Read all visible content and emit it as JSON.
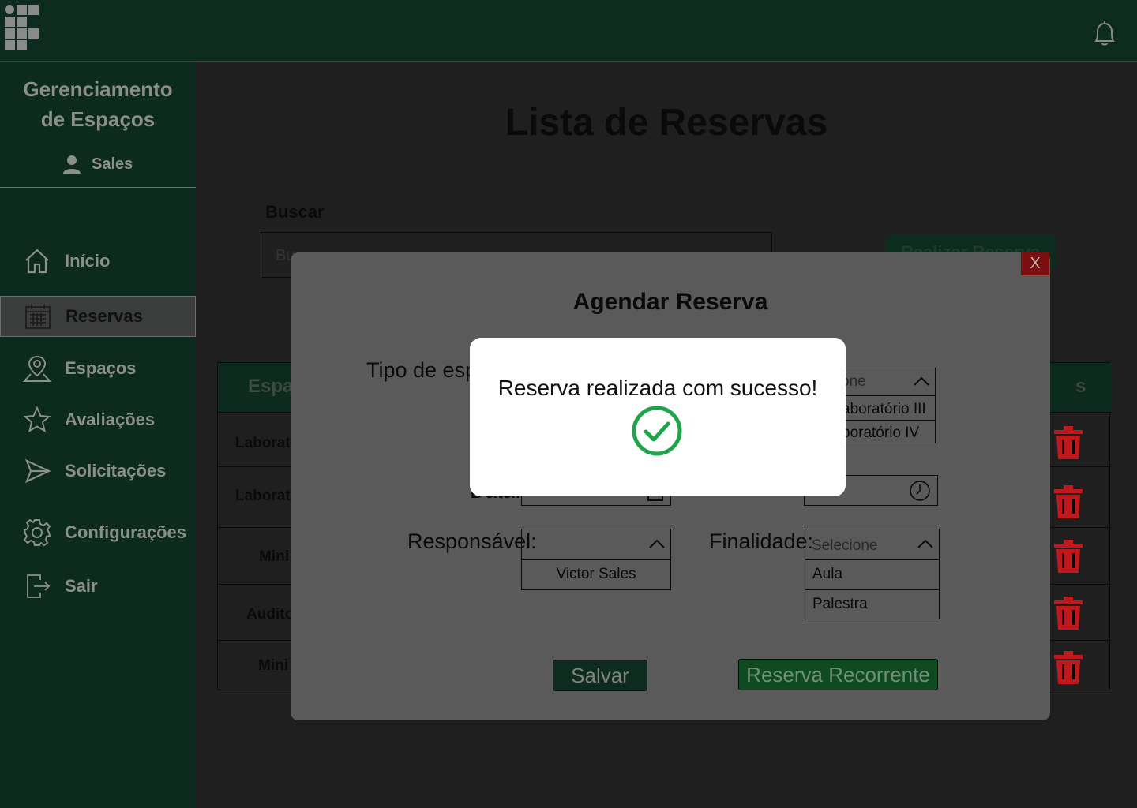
{
  "brand": {
    "line1": "Gerenciamento",
    "line2": "de Espaços"
  },
  "user": {
    "name": "Sales"
  },
  "sidebar": {
    "items": [
      {
        "label": "Início",
        "icon": "home-icon"
      },
      {
        "label": "Reservas",
        "icon": "calendar-icon",
        "active": true
      },
      {
        "label": "Espaços",
        "icon": "map-pin-icon"
      },
      {
        "label": "Avaliações",
        "icon": "star-icon"
      },
      {
        "label": "Solicitações",
        "icon": "send-icon"
      },
      {
        "label": "Configurações",
        "icon": "gear-icon"
      },
      {
        "label": "Sair",
        "icon": "logout-icon"
      }
    ]
  },
  "main": {
    "title": "Lista de Reservas",
    "search_label": "Buscar",
    "search_placeholder": "Bu",
    "realizar_button": "Realizar Reserva",
    "table": {
      "header_left": "Espa",
      "header_right": "s",
      "rows": [
        "Laborat",
        "Laborat",
        "Mini",
        "Audito",
        "Mini"
      ]
    }
  },
  "modal": {
    "title": "Agendar Reserva",
    "close_label": "X",
    "tipo_label": "Tipo de esp",
    "tipo_select": {
      "header": "one",
      "options": [
        "aboratório III",
        "boratório IV"
      ]
    },
    "data_label": "Data:",
    "responsavel_label": "Responsável:",
    "responsavel_select": {
      "header": "",
      "options": [
        "Victor Sales"
      ]
    },
    "finalidade_label": "Finalidade:",
    "finalidade_select": {
      "header": "Selecione",
      "options": [
        "Aula",
        "Palestra"
      ]
    },
    "salvar_button": "Salvar",
    "recorrente_button": "Reserva Recorrente"
  },
  "popup": {
    "message": "Reserva realizada com sucesso!"
  },
  "colors": {
    "sidebar": "#0d2a1e",
    "delete": "#c0181c",
    "success": "#1ea44a"
  }
}
